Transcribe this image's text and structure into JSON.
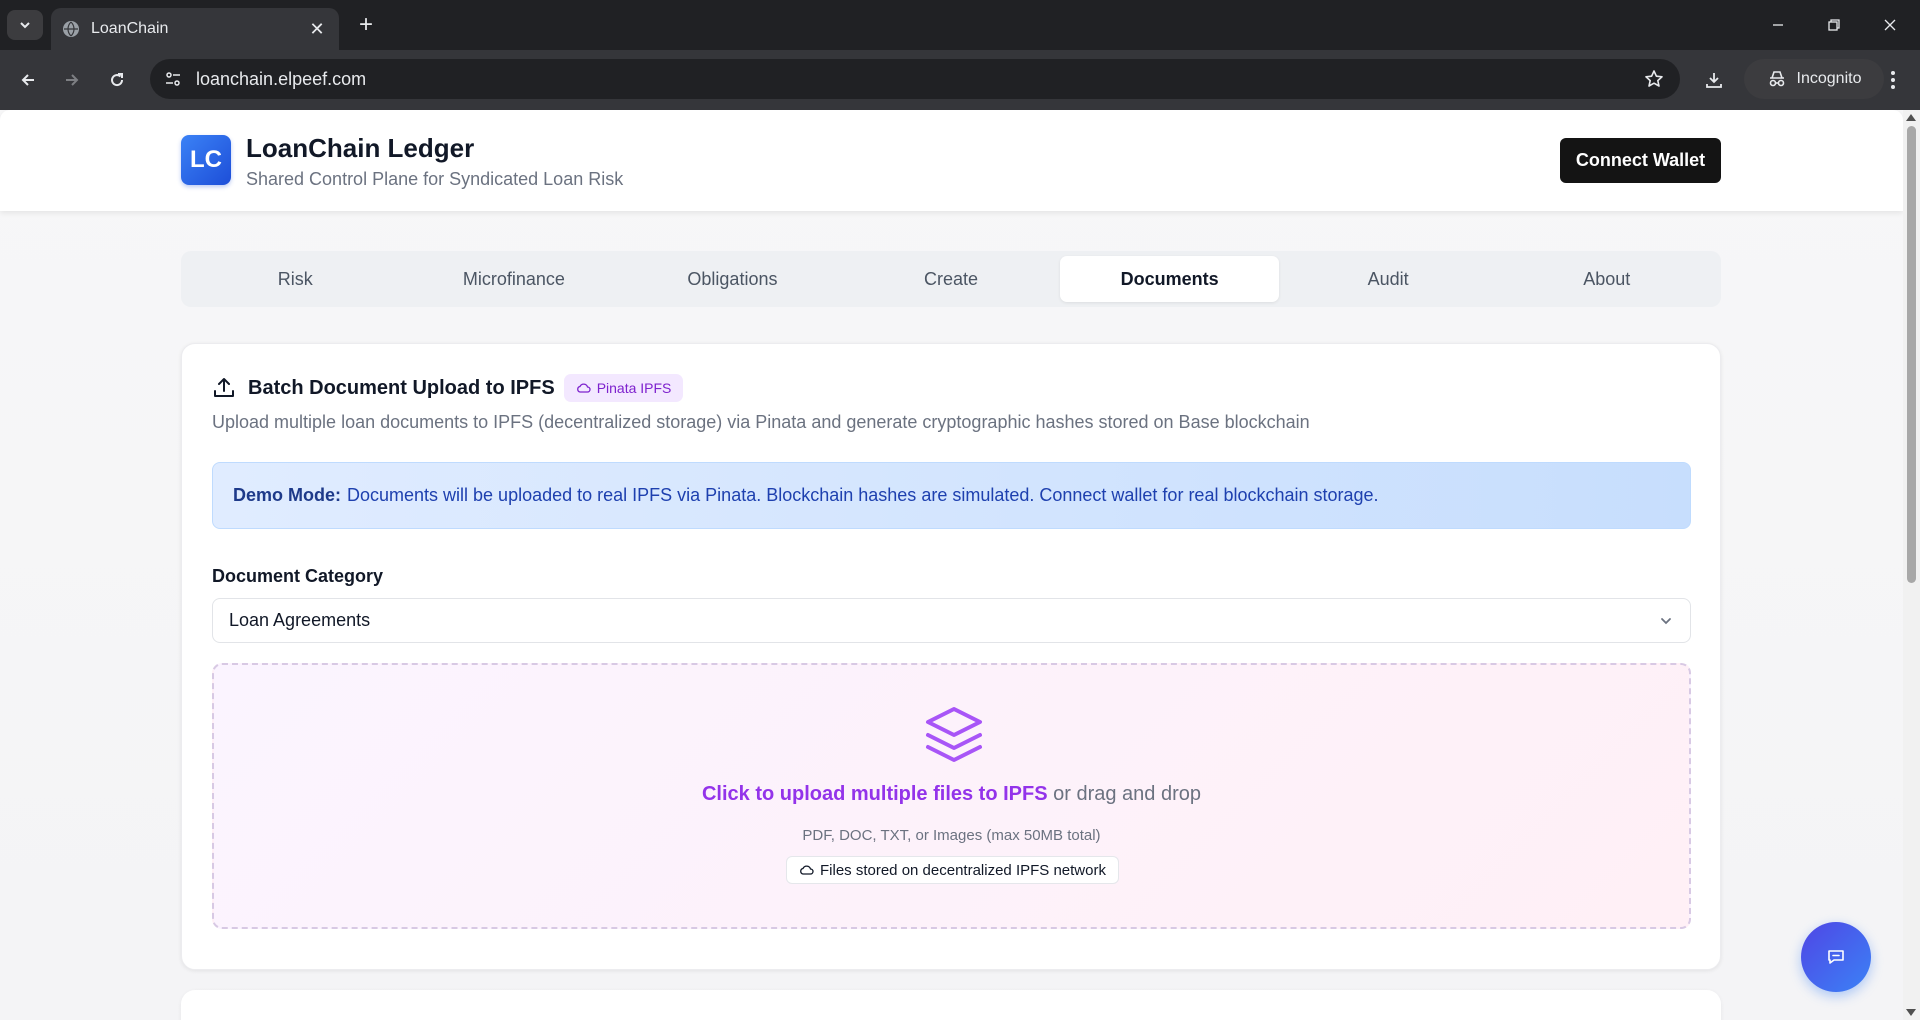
{
  "browser": {
    "tab_title": "LoanChain",
    "url": "loanchain.elpeef.com",
    "incognito_label": "Incognito"
  },
  "header": {
    "logo_text": "LC",
    "title": "LoanChain Ledger",
    "subtitle": "Shared Control Plane for Syndicated Loan Risk",
    "connect_label": "Connect Wallet"
  },
  "nav": {
    "tabs": [
      "Risk",
      "Microfinance",
      "Obligations",
      "Create",
      "Documents",
      "Audit",
      "About"
    ],
    "active": "Documents"
  },
  "upload_card": {
    "title": "Batch Document Upload to IPFS",
    "badge": "Pinata IPFS",
    "description": "Upload multiple loan documents to IPFS (decentralized storage) via Pinata and generate cryptographic hashes stored on Base blockchain",
    "alert_label": "Demo Mode:",
    "alert_text": "Documents will be uploaded to real IPFS via Pinata. Blockchain hashes are simulated. Connect wallet for real blockchain storage.",
    "category_label": "Document Category",
    "category_value": "Loan Agreements",
    "dropzone_cta": "Click to upload multiple files to IPFS",
    "dropzone_rest": " or drag and drop",
    "dropzone_hint": "PDF, DOC, TXT, or Images (max 50MB total)",
    "dropzone_badge": "Files stored on decentralized IPFS network"
  },
  "colors": {
    "accent": "#9333ea",
    "brand": "#1d4ed8",
    "alert_text": "#1e40af"
  }
}
